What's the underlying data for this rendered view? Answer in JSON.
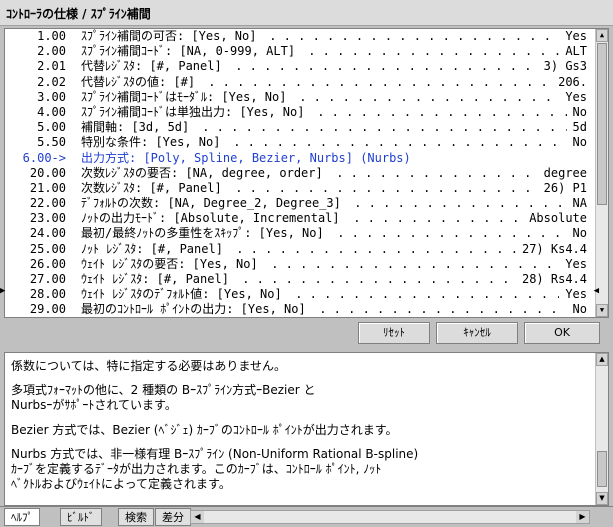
{
  "window": {
    "title": "ｺﾝﾄﾛｰﾗの仕様 / ｽﾌﾟﾗｲﾝ補間"
  },
  "rows": [
    {
      "num": "1.00",
      "text": "ｽﾌﾟﾗｲﾝ補間の可否: [Yes, No]",
      "value": "Yes"
    },
    {
      "num": "2.00",
      "text": "ｽﾌﾟﾗｲﾝ補間ｺｰﾄﾞ: [NA, 0-999, ALT]",
      "value": "ALT"
    },
    {
      "num": "2.01",
      "text": "代替ﾚｼﾞｽﾀ: [#, Panel]",
      "value": "3) Gs3"
    },
    {
      "num": "2.02",
      "text": "代替ﾚｼﾞｽﾀの値: [#]",
      "value": "206."
    },
    {
      "num": "3.00",
      "text": "ｽﾌﾟﾗｲﾝ補間ｺｰﾄﾞはﾓｰﾀﾞﾙ: [Yes, No]",
      "value": "Yes"
    },
    {
      "num": "4.00",
      "text": "ｽﾌﾟﾗｲﾝ補間ｺｰﾄﾞは単独出力: [Yes, No]",
      "value": "No"
    },
    {
      "num": "5.00",
      "text": "補間軸: [3d, 5d]",
      "value": "5d"
    },
    {
      "num": "5.50",
      "text": "特別な条件: [Yes, No]",
      "value": "No"
    },
    {
      "num": "6.00->",
      "text": "出力方式: [Poly, Spline, Bezier, Nurbs] (Nurbs)",
      "value": "",
      "highlight": true
    },
    {
      "num": "20.00",
      "text": "次数ﾚｼﾞｽﾀの要否: [NA, degree, order]",
      "value": "degree"
    },
    {
      "num": "21.00",
      "text": "次数ﾚｼﾞｽﾀ: [#, Panel]",
      "value": "26) P1"
    },
    {
      "num": "22.00",
      "text": "ﾃﾞﾌｫﾙﾄの次数: [NA, Degree_2, Degree_3]",
      "value": "NA"
    },
    {
      "num": "23.00",
      "text": "ﾉｯﾄの出力ﾓｰﾄﾞ: [Absolute, Incremental]",
      "value": "Absolute"
    },
    {
      "num": "24.00",
      "text": "最初/最終ﾉｯﾄの多重性をｽｷｯﾌﾟ: [Yes, No]",
      "value": "No"
    },
    {
      "num": "25.00",
      "text": "ﾉｯﾄ ﾚｼﾞｽﾀ: [#, Panel]",
      "value": "27) Ks4.4"
    },
    {
      "num": "26.00",
      "text": "ｳｪｲﾄ ﾚｼﾞｽﾀの要否: [Yes, No]",
      "value": "Yes"
    },
    {
      "num": "27.00",
      "text": "ｳｪｲﾄ ﾚｼﾞｽﾀ: [#, Panel]",
      "value": "28) Rs4.4"
    },
    {
      "num": "28.00",
      "text": "ｳｪｲﾄ ﾚｼﾞｽﾀのﾃﾞﾌｫﾙﾄ値: [Yes, No]",
      "value": "Yes"
    },
    {
      "num": "29.00",
      "text": "最初のｺﾝﾄﾛｰﾙ ﾎﾟｲﾝﾄの出力: [Yes, No]",
      "value": "No"
    }
  ],
  "buttons": {
    "reset": "ﾘｾｯﾄ",
    "cancel": "ｷｬﾝｾﾙ",
    "ok": "OK"
  },
  "help": [
    "係数については、特に指定する必要はありません。",
    "多項式ﾌｫｰﾏｯﾄの他に、2 種類の Bｰｽﾌﾟﾗｲﾝ方式ｰBezier と\nNurbsｰがｻﾎﾟｰﾄされています。",
    "Bezier 方式では、Bezier (ﾍﾞｼﾞｪ) ｶｰﾌﾞのｺﾝﾄﾛｰﾙ ﾎﾟｲﾝﾄが出力されます。",
    "Nurbs 方式では、非一様有理 Bｰｽﾌﾟﾗｲﾝ (Non-Uniform Rational B-spline)\nｶｰﾌﾞを定義するﾃﾞｰﾀが出力されます。このｶｰﾌﾞは、ｺﾝﾄﾛｰﾙ ﾎﾟｲﾝﾄ, ﾉｯﾄ\nﾍﾞｸﾄﾙおよびｳｪｲﾄによって定義されます。"
  ],
  "tabs": [
    "ﾍﾙﾌﾟ",
    "ﾋﾞﾙﾄﾞ",
    "検索",
    "差分"
  ],
  "icons": {
    "up": "arrow-up-icon",
    "down": "arrow-down-icon",
    "left": "arrow-left-icon",
    "right": "arrow-right-icon"
  }
}
